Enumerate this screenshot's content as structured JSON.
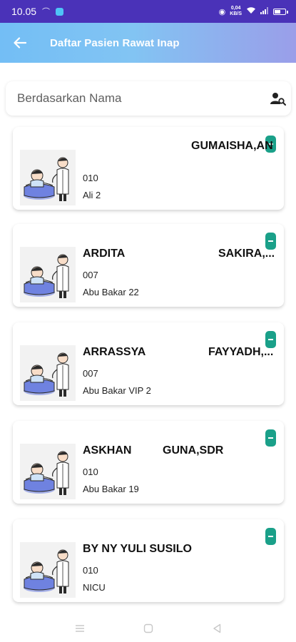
{
  "statusbar": {
    "time": "10.05",
    "speed_value": "0,04",
    "speed_unit": "KB/S",
    "battery_level": 0.6
  },
  "appbar": {
    "title": "Daftar Pasien Rawat Inap"
  },
  "search": {
    "placeholder": "Berdasarkan Nama"
  },
  "patients": [
    {
      "name_left": "",
      "name_right": "GUMAISHA,AN",
      "code": "010",
      "room": "Ali 2"
    },
    {
      "name_left": "ARDITA",
      "name_right": "SAKIRA,...",
      "code": "007",
      "room": "Abu Bakar 22"
    },
    {
      "name_left": "ARRASSYA",
      "name_right": "FAYYADH,...",
      "code": "007",
      "room": "Abu Bakar VIP 2"
    },
    {
      "name_left": "ASKHAN",
      "name_right": "GUNA,SDR",
      "code": "010",
      "room": "Abu Bakar 19"
    },
    {
      "name_left": "BY NY YULI SUSILO",
      "name_right": "",
      "code": "010",
      "room": "NICU"
    }
  ],
  "colors": {
    "statusbar": "#4a32b8",
    "badge": "#1aa089",
    "appbar_start": "#73bef5",
    "appbar_end": "#9a9ee9"
  }
}
